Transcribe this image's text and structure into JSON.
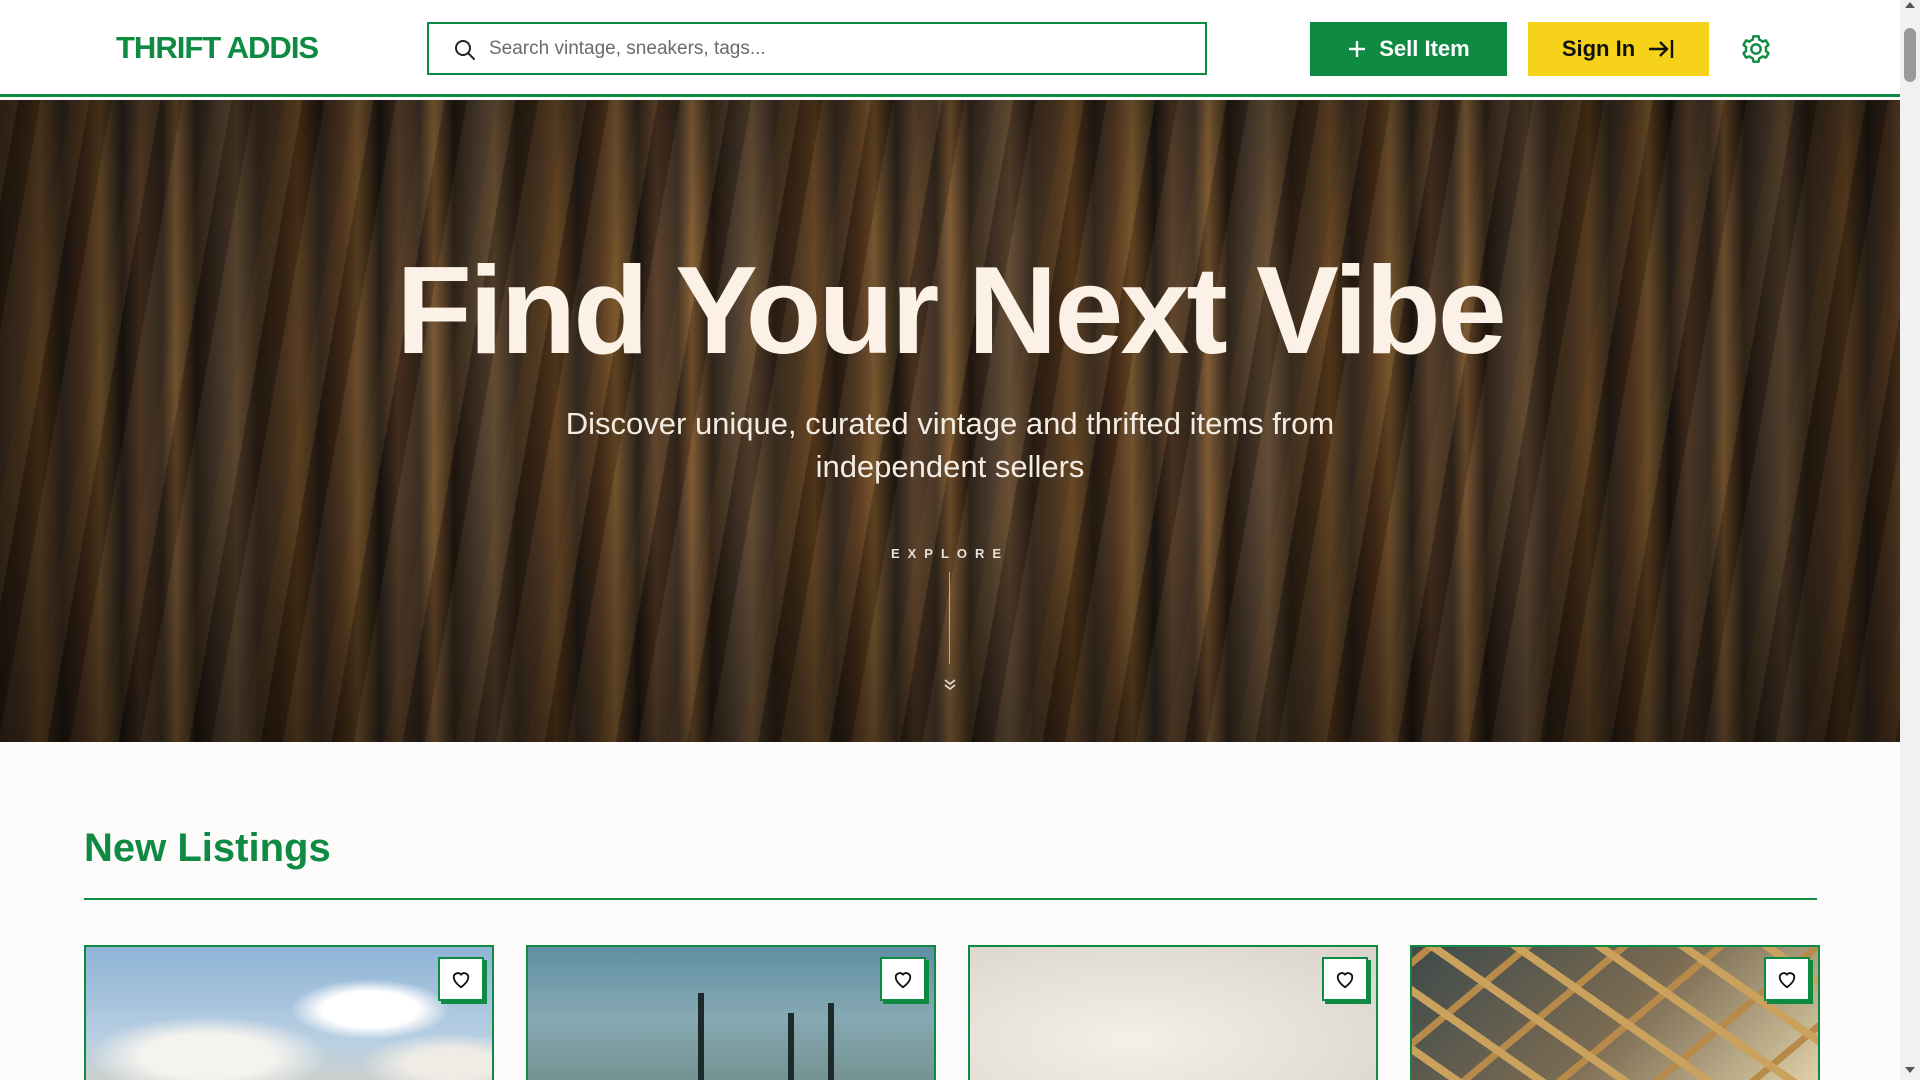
{
  "brand": {
    "name": "THRIFT ADDIS",
    "accent": "#0f8a43",
    "secondary": "#f6d21a"
  },
  "search": {
    "placeholder": "Search vintage, sneakers, tags..."
  },
  "header": {
    "sell_label": "Sell Item",
    "signin_label": "Sign In",
    "settings_icon": "gear-icon"
  },
  "hero": {
    "title": "Find Your Next Vibe",
    "subtitle": "Discover unique, curated vintage and thrifted items from independent sellers",
    "explore_label": "EXPLORE"
  },
  "listings": {
    "title": "New Listings",
    "cards": [
      {
        "image": "sky-clouds"
      },
      {
        "image": "palm-trees"
      },
      {
        "image": "light-blur"
      },
      {
        "image": "structure"
      }
    ]
  }
}
